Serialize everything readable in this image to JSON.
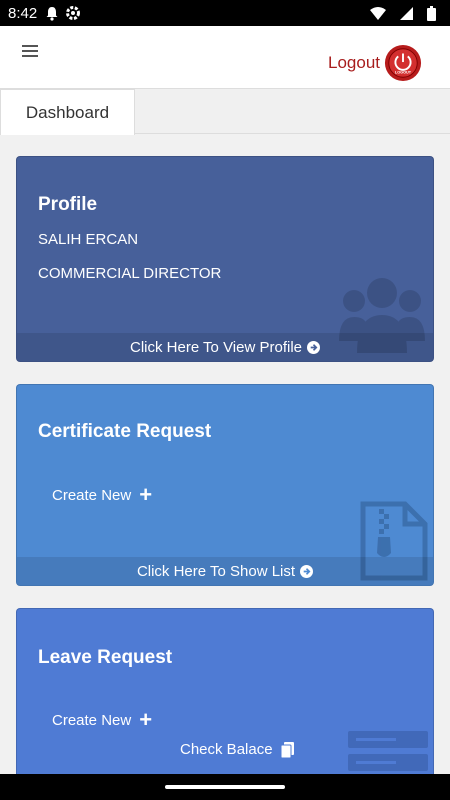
{
  "status_bar": {
    "time": "8:42",
    "left_icons": [
      "notification-bell-icon",
      "settings-gear-icon"
    ],
    "right_icons": [
      "wifi-icon",
      "signal-icon",
      "battery-icon"
    ]
  },
  "header": {
    "menu_icon": "hamburger-menu-icon",
    "logout_label": "Logout",
    "logout_icon_text": "LOGOUT"
  },
  "tabs": {
    "active": "Dashboard"
  },
  "profile_card": {
    "title": "Profile",
    "name": "SALIH ERCAN",
    "role": "COMMERCIAL DIRECTOR",
    "footer": "Click Here To View Profile",
    "bg_icon": "users-group-icon"
  },
  "certificate_card": {
    "title": "Certificate Request",
    "create": "Create New",
    "footer": "Click Here To Show List",
    "bg_icon": "zip-file-icon"
  },
  "leave_card": {
    "title": "Leave Request",
    "create": "Create New",
    "check_balance": "Check Balace",
    "bg_icon": "server-icon"
  },
  "colors": {
    "profile": "#47609a",
    "certificate": "#4e8ad2",
    "leave": "#4f7bd4",
    "logout": "#a81d1d"
  }
}
